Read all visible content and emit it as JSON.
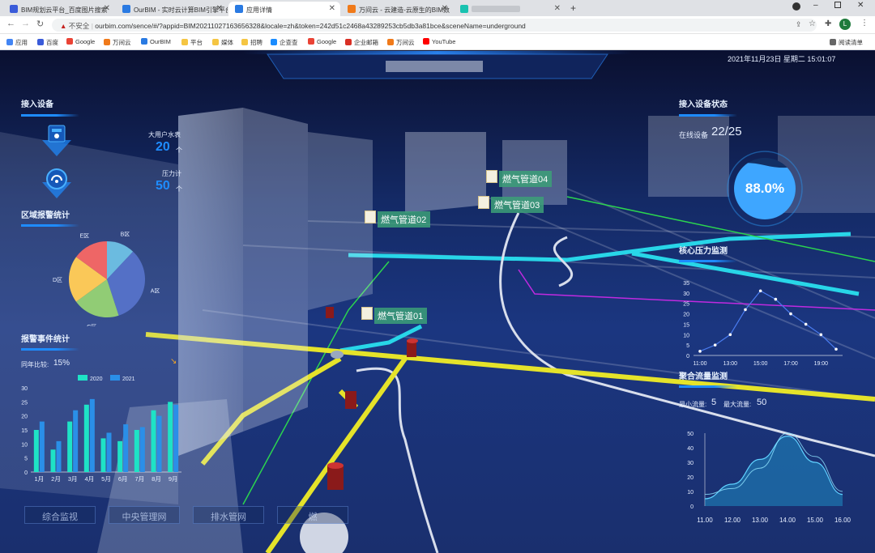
{
  "browser": {
    "tabs": [
      {
        "title": "BIM规划云平台_百度图片搜索",
        "active": false,
        "color": "#3a5bd9"
      },
      {
        "title": "OurBIM - 实时云计算BIM引擎平台",
        "active": false,
        "color": "#2a7ae2"
      },
      {
        "title": "应用详情",
        "active": true,
        "color": "#2a7ae2"
      },
      {
        "title": "万间云 - 云建造-云原生的BIM数",
        "active": false,
        "color": "#f07a1a"
      },
      {
        "title": "",
        "active": false,
        "color": "#19c2b0"
      }
    ],
    "security_label": "不安全",
    "url": "ourbim.com/sence/#/?appid=BIM20211027163656328&locale=zh&token=242d51c2468a43289253cb5db3a81bce&sceneName=underground",
    "bookmarks": [
      "应用",
      "百度",
      "Google",
      "万间云",
      "OurBIM",
      "平台",
      "媒体",
      "招聘",
      "企查查",
      "Google",
      "企业邮箱",
      "万间云",
      "YouTube"
    ],
    "reading_list": "阅读清单",
    "profile_initial": "L"
  },
  "header": {
    "datetime": "2021年11月23日 星期二 15:01:07"
  },
  "devices": {
    "title": "接入设备",
    "items": [
      {
        "label": "大用户水表",
        "value": "20",
        "unit": "个"
      },
      {
        "label": "压力计",
        "value": "50",
        "unit": "个"
      }
    ]
  },
  "alarm_area": {
    "title": "区域报警统计",
    "slice_labels": [
      "B区",
      "A区",
      "C区",
      "D区",
      "E区"
    ],
    "chart_data": {
      "type": "pie",
      "categories": [
        "B区",
        "A区",
        "C区",
        "D区",
        "E区"
      ],
      "values": [
        12,
        33,
        20,
        20,
        15
      ],
      "colors": [
        "#6bbbe0",
        "#5470c6",
        "#91cc75",
        "#fac858",
        "#ee6666"
      ]
    }
  },
  "alarm_events": {
    "title": "报警事件统计",
    "yoy_label": "同年比较:",
    "yoy_value": "15%",
    "chart_data": {
      "type": "bar",
      "categories": [
        "1月",
        "2月",
        "3月",
        "4月",
        "5月",
        "6月",
        "7月",
        "8月",
        "9月"
      ],
      "series": [
        {
          "name": "2020",
          "values": [
            15,
            8,
            18,
            24,
            12,
            11,
            15,
            22,
            25
          ],
          "color": "#1ee3c6"
        },
        {
          "name": "2021",
          "values": [
            18,
            11,
            22,
            26,
            14,
            17,
            16,
            20,
            24
          ],
          "color": "#2a8fe8"
        }
      ],
      "yticks": [
        "0",
        "5",
        "10",
        "15",
        "20",
        "25",
        "30"
      ],
      "ylim": [
        0,
        30
      ]
    }
  },
  "device_status": {
    "title": "接入设备状态",
    "online_label": "在线设备",
    "online_value": "22/25",
    "percent": "88.0%",
    "fraction": 0.88
  },
  "core_pressure": {
    "title": "核心压力监测",
    "chart_data": {
      "type": "line",
      "x": [
        "11:00",
        "12:00",
        "13:00",
        "14:00",
        "15:00",
        "16:00",
        "17:00",
        "18:00",
        "19:00",
        "20:00"
      ],
      "xticks": [
        "11:00",
        "13:00",
        "15:00",
        "17:00",
        "19:00"
      ],
      "values": [
        2,
        5,
        10,
        22,
        31,
        27,
        20,
        15,
        10,
        3
      ],
      "yticks": [
        "0",
        "5",
        "10",
        "15",
        "20",
        "25",
        "30",
        "35"
      ],
      "ylim": [
        0,
        35
      ]
    }
  },
  "aggregate_flow": {
    "title": "聚合流量监测",
    "min_label": "最小流量:",
    "min_value": "5",
    "max_label": "最大流量:",
    "max_value": "50",
    "chart_data": {
      "type": "area",
      "x": [
        "11.00",
        "12.00",
        "13.00",
        "14.00",
        "15.00",
        "16.00"
      ],
      "values": [
        5,
        15,
        32,
        48,
        30,
        8
      ],
      "values2": [
        8,
        12,
        26,
        50,
        34,
        10
      ],
      "yticks": [
        "0",
        "10",
        "20",
        "30",
        "40",
        "50"
      ],
      "ylim": [
        0,
        50
      ]
    }
  },
  "pipes": {
    "tags": [
      "燃气管道04",
      "燃气管道03",
      "燃气管道02",
      "燃气管道01"
    ]
  },
  "nav": {
    "buttons": [
      "综合监视",
      "中央管理网",
      "排水管网",
      "燃"
    ]
  }
}
